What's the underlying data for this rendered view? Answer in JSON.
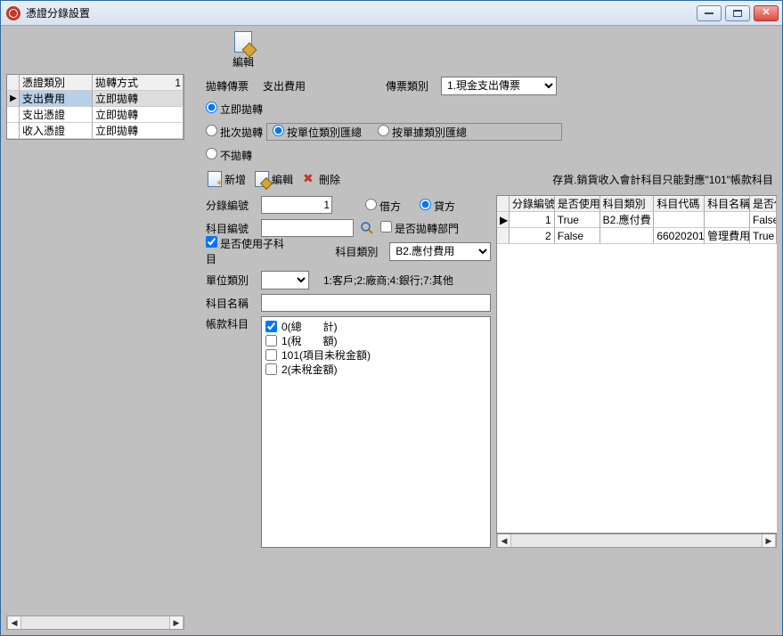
{
  "window": {
    "title": "憑證分錄設置"
  },
  "toolbar_big": {
    "edit_label": "編輯"
  },
  "left_table": {
    "col1": "憑證類別",
    "col2": "拋轉方式",
    "row_count_badge": "1",
    "rows": [
      {
        "c1": "支出費用",
        "c2": "立即拋轉",
        "selected": true
      },
      {
        "c1": "支出憑證",
        "c2": "立即拋轉",
        "selected": false
      },
      {
        "c1": "收入憑證",
        "c2": "立即拋轉",
        "selected": false
      }
    ]
  },
  "header": {
    "post_doc_label": "拋轉傳票",
    "post_doc_value": "支出費用",
    "doc_type_label": "傳票類別",
    "doc_type_value": "1.現金支出傳票"
  },
  "post_mode": {
    "immediate": "立即拋轉",
    "batch": "批次拋轉",
    "none": "不拋轉",
    "sum_by_unit": "按單位類別匯總",
    "sum_by_bill": "按單據類別匯總"
  },
  "mini": {
    "add": "新增",
    "edit": "編輯",
    "delete": "刪除",
    "tip": "存貨.銷貨收入會計科目只能對應\"101\"帳款科目"
  },
  "form": {
    "entry_no_label": "分錄編號",
    "entry_no_value": "1",
    "debit": "借方",
    "credit": "貸方",
    "acct_no_label": "科目編號",
    "acct_no_value": "",
    "is_post_dept": "是否拋轉部門",
    "use_sub_acct": "是否使用子科目",
    "acct_type_label": "科目類別",
    "acct_type_value": "B2.應付費用",
    "unit_type_label": "單位類別",
    "unit_hint": "1:客戶;2:廠商;4:銀行;7:其他",
    "acct_name_label": "科目名稱",
    "acct_name_value": "",
    "amount_acct_label": "帳款科目",
    "amount_options": [
      {
        "label": "0(總　　計)",
        "checked": true
      },
      {
        "label": "1(稅　　額)",
        "checked": false
      },
      {
        "label": "101(項目未稅金額)",
        "checked": false
      },
      {
        "label": "2(未稅金額)",
        "checked": false
      }
    ]
  },
  "right_table": {
    "h_gutter": "",
    "h1": "分錄編號",
    "h2": "是否使用",
    "h3": "科目類別",
    "h4": "科目代碼",
    "h5": "科目名稱",
    "h6": "是否使",
    "rows": [
      {
        "g": "▶",
        "c1": "1",
        "c2": "True",
        "c3": "B2.應付費",
        "c4": "",
        "c5": "",
        "c6": "False"
      },
      {
        "g": "",
        "c1": "2",
        "c2": "False",
        "c3": "",
        "c4": "66020201",
        "c5": "管理費用",
        "c6": "True"
      }
    ]
  }
}
